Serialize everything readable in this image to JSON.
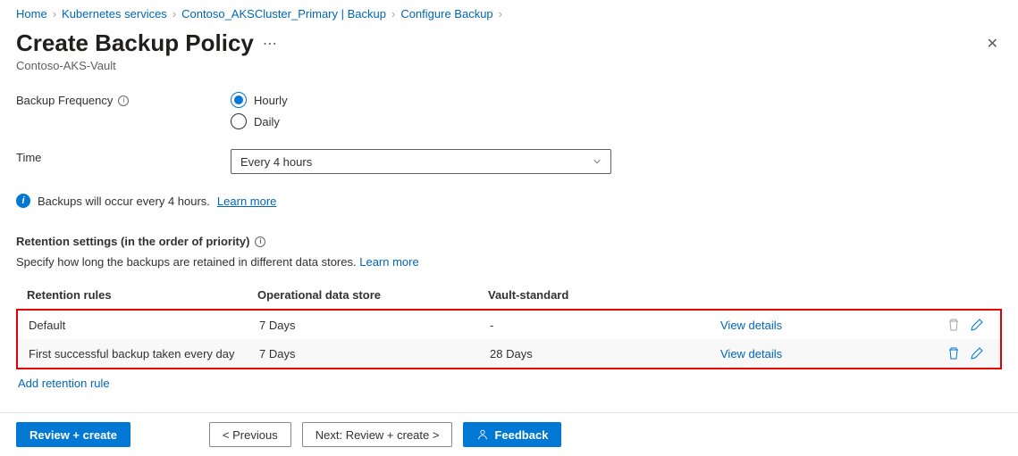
{
  "breadcrumb": {
    "items": [
      {
        "label": "Home"
      },
      {
        "label": "Kubernetes services"
      },
      {
        "label": "Contoso_AKSCluster_Primary | Backup"
      },
      {
        "label": "Configure Backup"
      }
    ]
  },
  "header": {
    "title": "Create Backup Policy",
    "subtitle": "Contoso-AKS-Vault"
  },
  "form": {
    "frequency_label": "Backup Frequency",
    "frequency_options": {
      "hourly": "Hourly",
      "daily": "Daily"
    },
    "frequency_selected": "hourly",
    "time_label": "Time",
    "time_value": "Every 4 hours"
  },
  "info_banner": {
    "text": "Backups will occur every 4 hours.",
    "link": "Learn more"
  },
  "retention": {
    "section_title": "Retention settings (in the order of priority)",
    "section_desc": "Specify how long the backups are retained in different data stores.",
    "learn_more": "Learn more",
    "headers": {
      "rules": "Retention rules",
      "ods": "Operational data store",
      "vault": "Vault-standard"
    },
    "rows": [
      {
        "rule": "Default",
        "ods": "7 Days",
        "vault": "-",
        "view": "View details"
      },
      {
        "rule": "First successful backup taken every day",
        "ods": "7 Days",
        "vault": "28 Days",
        "view": "View details"
      }
    ],
    "add_rule": "Add retention rule"
  },
  "footer": {
    "review": "Review + create",
    "previous": "< Previous",
    "next": "Next: Review + create >",
    "feedback": "Feedback"
  }
}
